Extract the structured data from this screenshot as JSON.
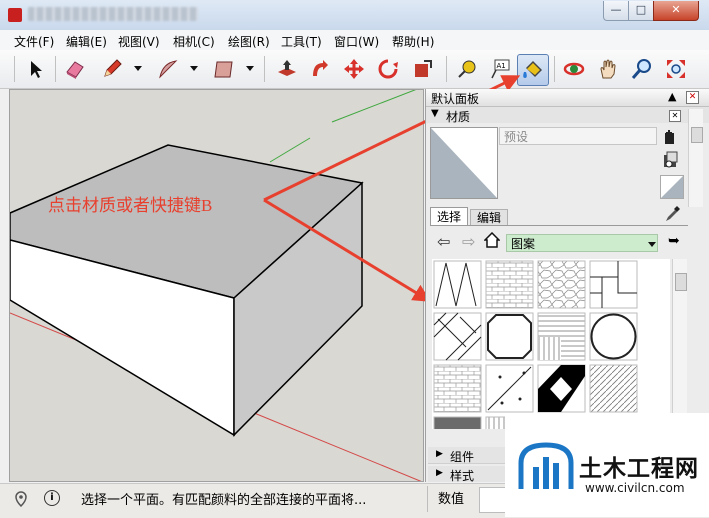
{
  "menu": [
    "文件(F)",
    "编辑(E)",
    "视图(V)",
    "相机(C)",
    "绘图(R)",
    "工具(T)",
    "窗口(W)",
    "帮助(H)"
  ],
  "toolbar": {
    "icons": [
      "select-arrow-icon",
      "eraser-icon",
      "pencil-icon",
      "arc-icon",
      "rectangle-icon",
      "push-pull-icon",
      "follow-me-icon",
      "move-icon",
      "rotate-icon",
      "scale-icon",
      "tape-measure-icon",
      "text-icon",
      "paint-bucket-icon",
      "orbit-icon",
      "pan-icon",
      "zoom-icon",
      "zoom-extents-icon"
    ],
    "text_tool_glyph": "A1"
  },
  "tray": {
    "title": "默认面板",
    "materials": {
      "header": "材质",
      "name_placeholder": "预设",
      "tabs": [
        "选择",
        "编辑"
      ],
      "category": "图案"
    },
    "collapsed_sections": [
      "组件",
      "样式"
    ]
  },
  "annotation": {
    "text": "点击材质或者快捷键B",
    "color": "#e8402e"
  },
  "status": {
    "message": "选择一个平面。有匹配颜料的全部连接的平面将...",
    "measurement_label": "数值"
  },
  "watermark": {
    "title": "土木工程网",
    "url": "www.civilcn.com"
  }
}
